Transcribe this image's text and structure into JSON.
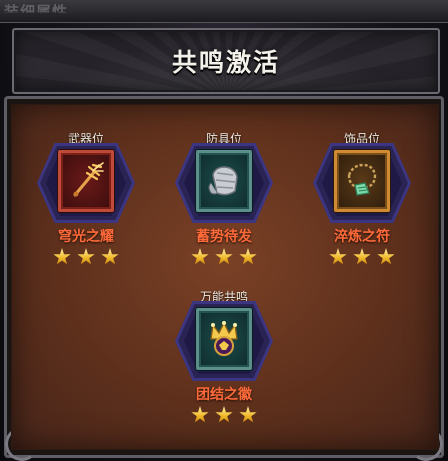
{
  "top_strip_text": "装细属性",
  "header": {
    "title": "共鸣激活"
  },
  "slots": [
    {
      "slot_label": "武器位",
      "item_name": "穹光之耀",
      "stars": 3,
      "icon": "trident-icon",
      "frame_color": "#c04a3a"
    },
    {
      "slot_label": "防具位",
      "item_name": "蓄势待发",
      "stars": 3,
      "icon": "gauntlet-icon",
      "frame_color": "#5b8f8c"
    },
    {
      "slot_label": "饰品位",
      "item_name": "淬炼之符",
      "stars": 3,
      "icon": "amulet-icon",
      "frame_color": "#d08a33"
    },
    {
      "slot_label": "万能共鸣",
      "item_name": "团结之徽",
      "stars": 3,
      "icon": "crown-emblem-icon",
      "frame_color": "#5b8f8c"
    }
  ],
  "colors": {
    "item_name": "#ff6a3a",
    "star": "#f0b829",
    "panel": "#5e301c",
    "emblem": "#2a2454"
  }
}
